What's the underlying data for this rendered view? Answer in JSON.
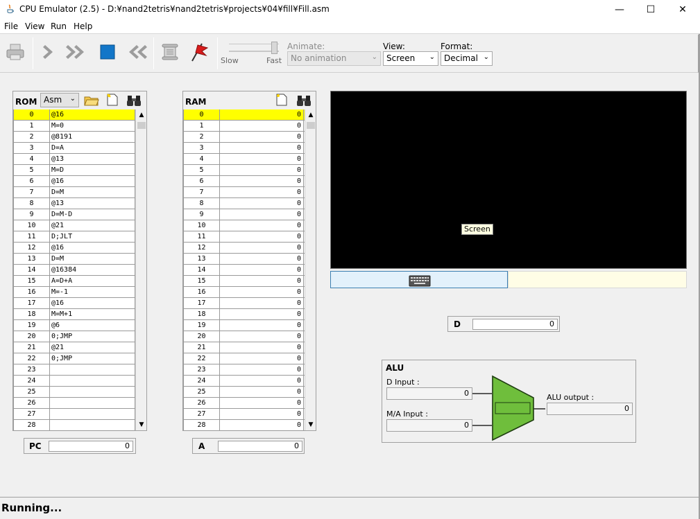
{
  "window": {
    "title": "CPU Emulator (2.5) - D:¥nand2tetris¥nand2tetris¥projects¥04¥fill¥Fill.asm",
    "minimize": "—",
    "maximize": "☐",
    "close": "✕"
  },
  "menu": [
    "File",
    "View",
    "Run",
    "Help"
  ],
  "toolbar": {
    "speed_slow": "Slow",
    "speed_fast": "Fast",
    "animate_label": "Animate:",
    "animate_value": "No animation",
    "view_label": "View:",
    "view_value": "Screen",
    "format_label": "Format:",
    "format_value": "Decimal"
  },
  "rom": {
    "title": "ROM",
    "mode": "Asm",
    "selected_row": 0,
    "rows": [
      [
        "0",
        "@16"
      ],
      [
        "1",
        "M=0"
      ],
      [
        "2",
        "@8191"
      ],
      [
        "3",
        "D=A"
      ],
      [
        "4",
        "@13"
      ],
      [
        "5",
        "M=D"
      ],
      [
        "6",
        "@16"
      ],
      [
        "7",
        "D=M"
      ],
      [
        "8",
        "@13"
      ],
      [
        "9",
        "D=M-D"
      ],
      [
        "10",
        "@21"
      ],
      [
        "11",
        "D;JLT"
      ],
      [
        "12",
        "@16"
      ],
      [
        "13",
        "D=M"
      ],
      [
        "14",
        "@16384"
      ],
      [
        "15",
        "A=D+A"
      ],
      [
        "16",
        "M=-1"
      ],
      [
        "17",
        "@16"
      ],
      [
        "18",
        "M=M+1"
      ],
      [
        "19",
        "@6"
      ],
      [
        "20",
        "0;JMP"
      ],
      [
        "21",
        "@21"
      ],
      [
        "22",
        "0;JMP"
      ],
      [
        "23",
        ""
      ],
      [
        "24",
        ""
      ],
      [
        "25",
        ""
      ],
      [
        "26",
        ""
      ],
      [
        "27",
        ""
      ],
      [
        "28",
        ""
      ]
    ]
  },
  "ram": {
    "title": "RAM",
    "selected_row": 0,
    "rows": [
      [
        "0",
        "0"
      ],
      [
        "1",
        "0"
      ],
      [
        "2",
        "0"
      ],
      [
        "3",
        "0"
      ],
      [
        "4",
        "0"
      ],
      [
        "5",
        "0"
      ],
      [
        "6",
        "0"
      ],
      [
        "7",
        "0"
      ],
      [
        "8",
        "0"
      ],
      [
        "9",
        "0"
      ],
      [
        "10",
        "0"
      ],
      [
        "11",
        "0"
      ],
      [
        "12",
        "0"
      ],
      [
        "13",
        "0"
      ],
      [
        "14",
        "0"
      ],
      [
        "15",
        "0"
      ],
      [
        "16",
        "0"
      ],
      [
        "17",
        "0"
      ],
      [
        "18",
        "0"
      ],
      [
        "19",
        "0"
      ],
      [
        "20",
        "0"
      ],
      [
        "21",
        "0"
      ],
      [
        "22",
        "0"
      ],
      [
        "23",
        "0"
      ],
      [
        "24",
        "0"
      ],
      [
        "25",
        "0"
      ],
      [
        "26",
        "0"
      ],
      [
        "27",
        "0"
      ],
      [
        "28",
        "0"
      ]
    ]
  },
  "registers": {
    "pc_label": "PC",
    "pc_value": "0",
    "a_label": "A",
    "a_value": "0",
    "d_label": "D",
    "d_value": "0"
  },
  "screen": {
    "tooltip": "Screen"
  },
  "alu": {
    "title": "ALU",
    "d_input_label": "D Input :",
    "d_input_value": "0",
    "ma_input_label": "M/A Input :",
    "ma_input_value": "0",
    "output_label": "ALU output :",
    "output_value": "0"
  },
  "status": "Running...",
  "colors": {
    "highlight": "#ffff00",
    "alu_fill": "#6fbe3c",
    "play_blue": "#1276c8",
    "screen": "#000000"
  }
}
